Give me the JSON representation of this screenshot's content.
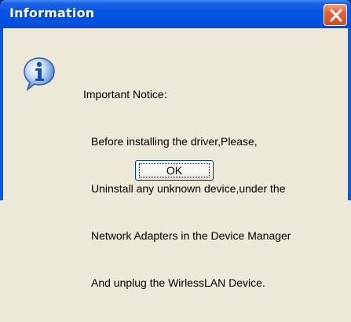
{
  "window": {
    "title": "Information"
  },
  "titlebar": {
    "close_icon": "close-x-icon"
  },
  "dialog": {
    "icon": "info-icon",
    "heading": "Important Notice:",
    "lines": [
      "Before installing the driver,Please,",
      "Uninstall any unknown device,under the",
      "Network Adapters in the Device Manager",
      "And unplug the WirlessLAN Device."
    ]
  },
  "buttons": {
    "ok_label": "OK"
  },
  "colors": {
    "titlebar": "#0054e3",
    "close_button": "#e2643b",
    "dialog_background": "#ece9d8"
  }
}
